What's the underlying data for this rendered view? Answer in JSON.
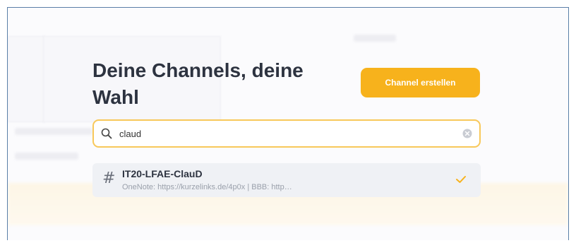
{
  "modal": {
    "title": "Deine Channels, deine Wahl",
    "create_button_label": "Channel erstellen"
  },
  "search": {
    "value": "claud",
    "icon": "search-icon",
    "clear_icon": "clear-icon"
  },
  "results": [
    {
      "icon": "hash-icon",
      "name": "IT20-LFAE-ClauD",
      "description": "OneNote: https://kurzelinks.de/4p0x | BBB: http…",
      "selected": true
    }
  ],
  "colors": {
    "accent": "#f7b21c",
    "search_border": "#f8c85a",
    "title": "#2d3340",
    "result_bg": "#eff1f5",
    "frame_border": "#5a7fa8"
  }
}
